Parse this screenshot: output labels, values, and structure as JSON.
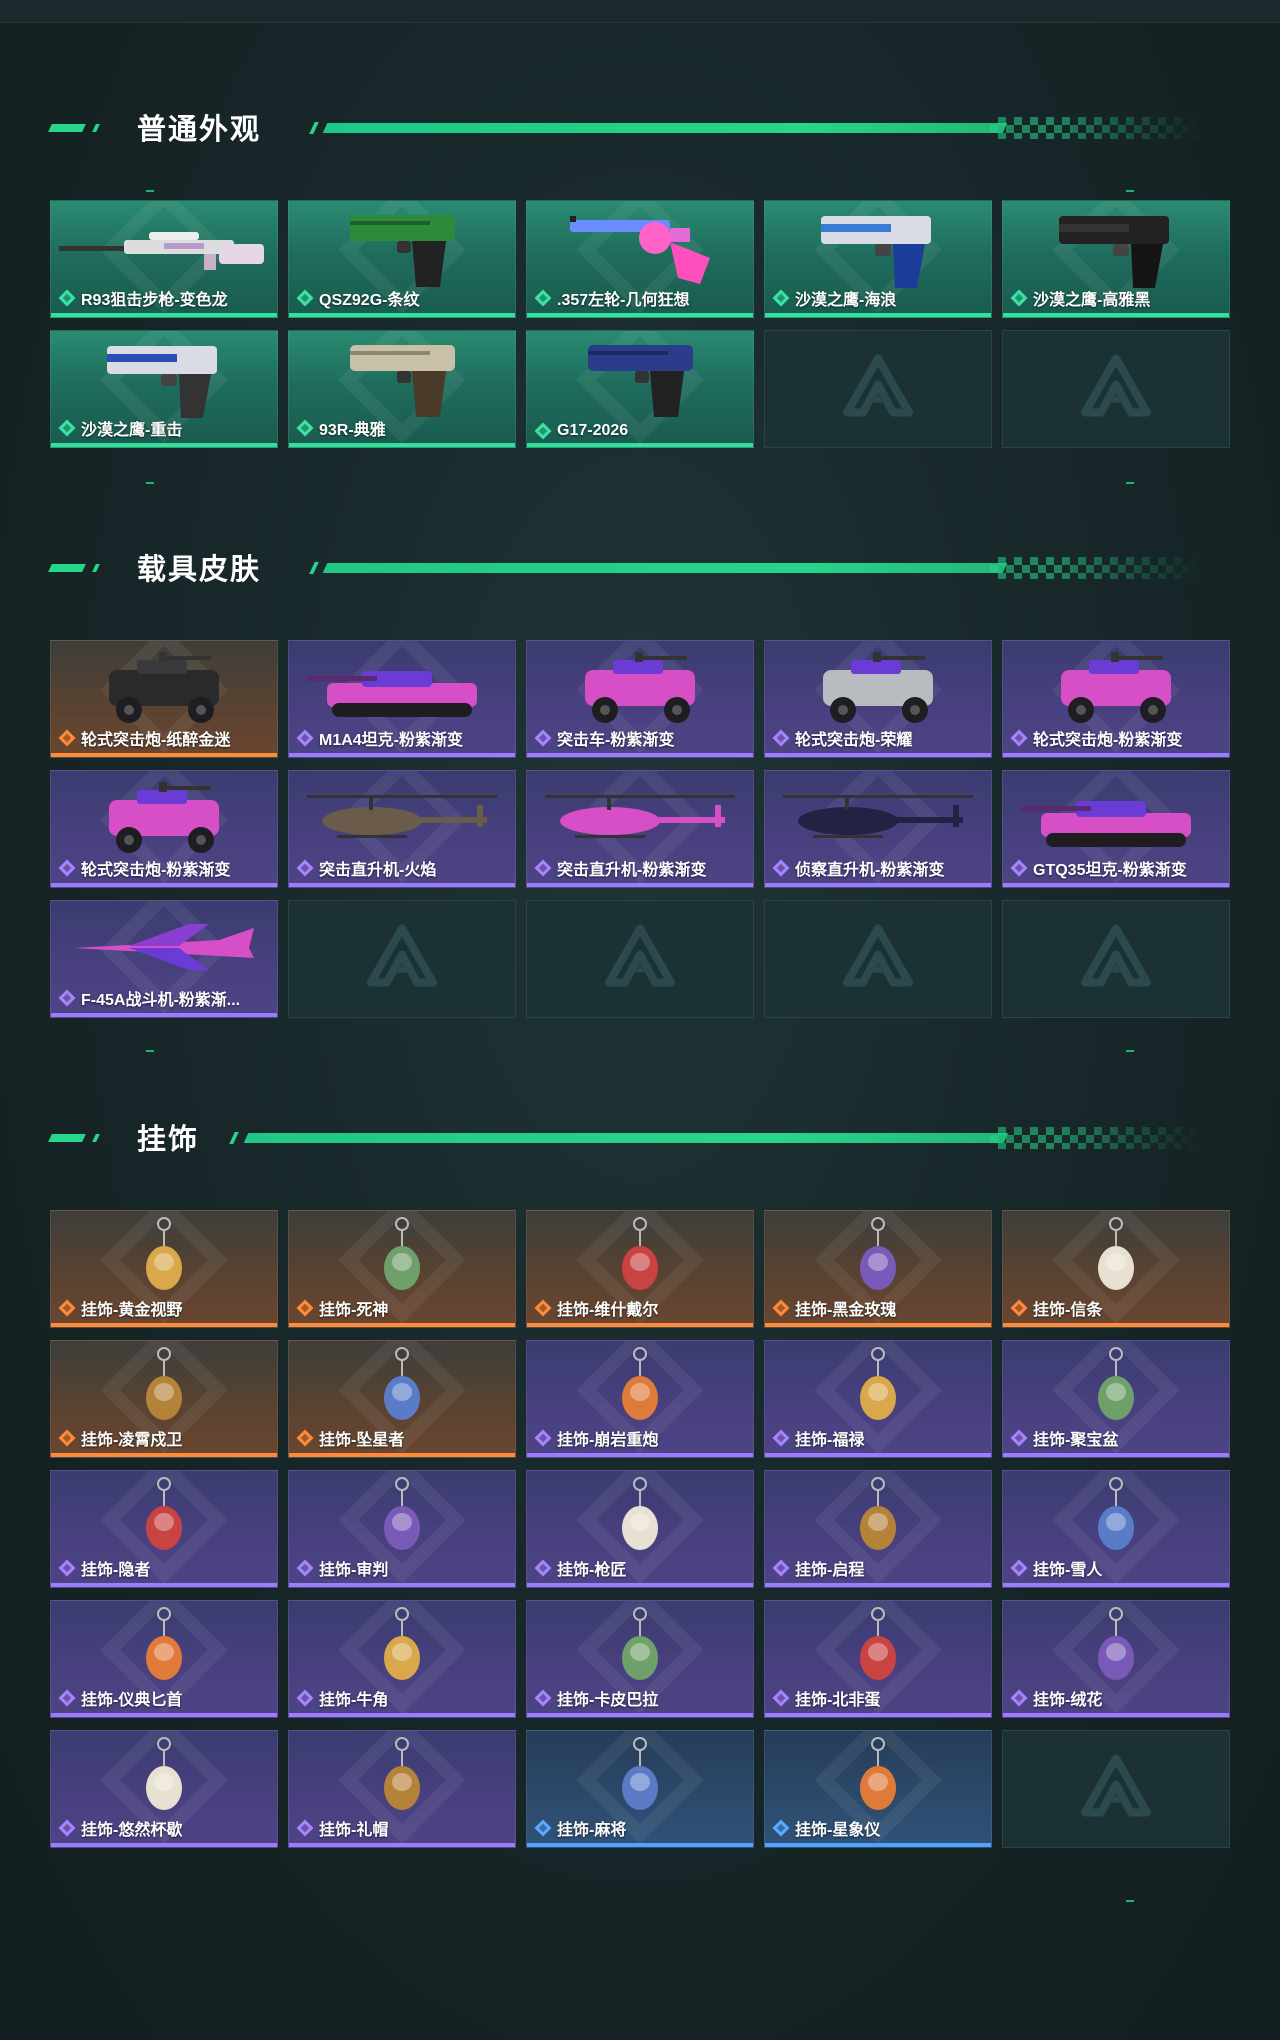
{
  "sections": {
    "skins": {
      "title": "普通外观",
      "items": [
        {
          "label": "R93狙击步枪-变色龙",
          "tier": "green",
          "icon": "sniper-rifle-icon"
        },
        {
          "label": "QSZ92G-条纹",
          "tier": "green",
          "icon": "pistol-icon"
        },
        {
          "label": ".357左轮-几何狂想",
          "tier": "green",
          "icon": "revolver-icon"
        },
        {
          "label": "沙漠之鹰-海浪",
          "tier": "green",
          "icon": "desert-eagle-icon"
        },
        {
          "label": "沙漠之鹰-高雅黑",
          "tier": "green",
          "icon": "desert-eagle-icon"
        },
        {
          "label": "沙漠之鹰-重击",
          "tier": "green",
          "icon": "desert-eagle-icon"
        },
        {
          "label": "93R-典雅",
          "tier": "green",
          "icon": "pistol-icon"
        },
        {
          "label": "G17-2026",
          "tier": "green",
          "icon": "pistol-icon"
        }
      ]
    },
    "vehicles": {
      "title": "载具皮肤",
      "items": [
        {
          "label": "轮式突击炮-纸醉金迷",
          "tier": "orange",
          "icon": "armored-car-icon"
        },
        {
          "label": "M1A4坦克-粉紫渐变",
          "tier": "purple",
          "icon": "tank-icon"
        },
        {
          "label": "突击车-粉紫渐变",
          "tier": "purple",
          "icon": "armored-car-icon"
        },
        {
          "label": "轮式突击炮-荣耀",
          "tier": "purple",
          "icon": "armored-car-icon"
        },
        {
          "label": "轮式突击炮-粉紫渐变",
          "tier": "purple",
          "icon": "armored-car-icon"
        },
        {
          "label": "轮式突击炮-粉紫渐变",
          "tier": "purple",
          "icon": "armored-car-icon"
        },
        {
          "label": "突击直升机-火焰",
          "tier": "purple",
          "icon": "helicopter-icon"
        },
        {
          "label": "突击直升机-粉紫渐变",
          "tier": "purple",
          "icon": "helicopter-icon"
        },
        {
          "label": "侦察直升机-粉紫渐变",
          "tier": "purple",
          "icon": "helicopter-icon"
        },
        {
          "label": "GTQ35坦克-粉紫渐变",
          "tier": "purple",
          "icon": "tank-icon"
        },
        {
          "label": "F-45A战斗机-粉紫渐...",
          "tier": "purple",
          "icon": "jet-icon"
        }
      ]
    },
    "charms": {
      "title": "挂饰",
      "items": [
        {
          "label": "挂饰-黄金视野",
          "tier": "orange",
          "icon": "charm-icon"
        },
        {
          "label": "挂饰-死神",
          "tier": "orange",
          "icon": "charm-icon"
        },
        {
          "label": "挂饰-维什戴尔",
          "tier": "orange",
          "icon": "charm-icon"
        },
        {
          "label": "挂饰-黑金玫瑰",
          "tier": "orange",
          "icon": "charm-icon"
        },
        {
          "label": "挂饰-信条",
          "tier": "orange",
          "icon": "charm-icon"
        },
        {
          "label": "挂饰-凌霄戍卫",
          "tier": "orange",
          "icon": "charm-icon"
        },
        {
          "label": "挂饰-坠星者",
          "tier": "orange",
          "icon": "charm-icon"
        },
        {
          "label": "挂饰-崩岩重炮",
          "tier": "purple",
          "icon": "charm-icon"
        },
        {
          "label": "挂饰-福禄",
          "tier": "purple",
          "icon": "charm-icon"
        },
        {
          "label": "挂饰-聚宝盆",
          "tier": "purple",
          "icon": "charm-icon"
        },
        {
          "label": "挂饰-隐者",
          "tier": "purple",
          "icon": "charm-icon"
        },
        {
          "label": "挂饰-审判",
          "tier": "purple",
          "icon": "charm-icon"
        },
        {
          "label": "挂饰-枪匠",
          "tier": "purple",
          "icon": "charm-icon"
        },
        {
          "label": "挂饰-启程",
          "tier": "purple",
          "icon": "charm-icon"
        },
        {
          "label": "挂饰-雪人",
          "tier": "purple",
          "icon": "charm-icon"
        },
        {
          "label": "挂饰-仪典匕首",
          "tier": "purple",
          "icon": "charm-icon"
        },
        {
          "label": "挂饰-牛角",
          "tier": "purple",
          "icon": "charm-icon"
        },
        {
          "label": "挂饰-卡皮巴拉",
          "tier": "purple",
          "icon": "charm-icon"
        },
        {
          "label": "挂饰-北非蛋",
          "tier": "purple",
          "icon": "charm-icon"
        },
        {
          "label": "挂饰-绒花",
          "tier": "purple",
          "icon": "charm-icon"
        },
        {
          "label": "挂饰-悠然杯歇",
          "tier": "purple",
          "icon": "charm-icon"
        },
        {
          "label": "挂饰-礼帽",
          "tier": "purple",
          "icon": "charm-icon"
        },
        {
          "label": "挂饰-麻将",
          "tier": "blue",
          "icon": "charm-icon"
        },
        {
          "label": "挂饰-星象仪",
          "tier": "blue",
          "icon": "charm-icon"
        }
      ]
    }
  },
  "colors": {
    "accent": "#27d68a",
    "tier_green": "#2fe39a",
    "tier_purple": "#9d7bff",
    "tier_orange": "#ff8a3a",
    "tier_blue": "#4fa3ff"
  }
}
